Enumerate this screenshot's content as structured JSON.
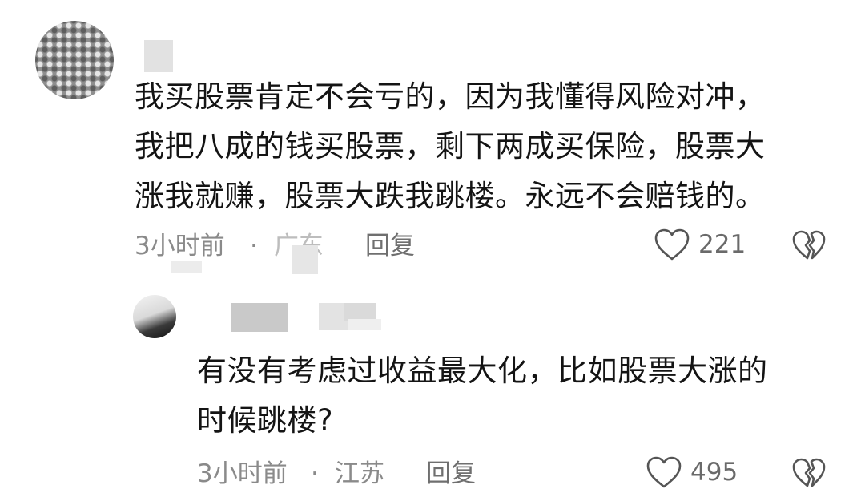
{
  "comment": {
    "text": "我买股票肯定不会亏的，因为我懂得风险对冲，\n我把八成的钱买股票，剩下两成买保险，股票大\n涨我就赚，股票大跌我跳楼。永远不会赔钱的。",
    "time": "3小时前",
    "separator": "·",
    "location": "广东",
    "reply_label": "回复",
    "likes": "221",
    "icons": [
      "heart-icon",
      "broken-heart-icon"
    ]
  },
  "reply": {
    "text": "有没有考虑过收益最大化，比如股票大涨的\n时候跳楼?",
    "time": "3小时前",
    "separator": "·",
    "location": "江苏",
    "reply_label": "回复",
    "likes": "495",
    "icons": [
      "heart-icon",
      "broken-heart-icon"
    ]
  },
  "colors": {
    "text": "#141414",
    "meta": "#8a8a8a",
    "icon": "#555555"
  }
}
